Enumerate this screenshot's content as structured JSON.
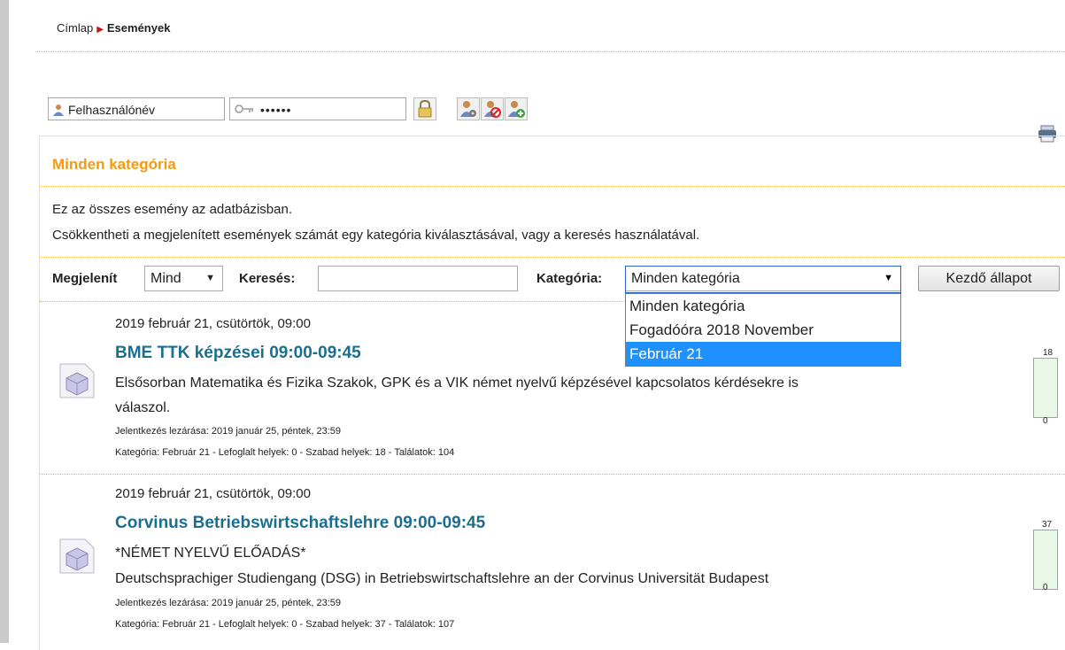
{
  "breadcrumb": {
    "home": "Címlap",
    "current": "Események"
  },
  "login": {
    "username_placeholder": "Felhasználónév",
    "password_value": "••••••"
  },
  "category": {
    "title": "Minden kategória",
    "description_line1": "Ez az összes esemény az adatbázisban.",
    "description_line2": "Csökkentheti a megjelenített események számát egy kategória kiválasztásával, vagy a keresés használatával."
  },
  "filters": {
    "show_label": "Megjelenít",
    "show_value": "Mind",
    "search_label": "Keresés:",
    "search_value": "",
    "category_label": "Kategória:",
    "category_value": "Minden kategória",
    "category_options": [
      "Minden kategória",
      "Fogadóóra 2018 November",
      "Február 21"
    ],
    "highlighted_option": "Február 21",
    "reset_button": "Kezdő állapot"
  },
  "events": [
    {
      "date": "2019 február 21, csütörtök, 09:00",
      "title": "BME TTK képzései 09:00-09:45",
      "description_line1": "Elsősorban Matematika és Fizika Szakok, GPK és a VIK német nyelvű képzésével kapcsolatos kérdésekre is",
      "description_line2": "válaszol.",
      "deadline": "Jelentkezés lezárása: 2019 január 25, péntek, 23:59",
      "meta": "Kategória: Február 21 - Lefoglalt helyek: 0 - Szabad helyek: 18 - Találatok: 104",
      "capacity_max": "18",
      "capacity_min": "0",
      "booked": 0
    },
    {
      "date": "2019 február 21, csütörtök, 09:00",
      "title": "Corvinus Betriebswirtschaftslehre 09:00-09:45",
      "description_line1": "*NÉMET NYELVŰ ELŐADÁS*",
      "description_line2": "Deutschsprachiger Studiengang (DSG) in Betriebswirtschaftslehre an der Corvinus Universität Budapest",
      "deadline": "Jelentkezés lezárása: 2019 január 25, péntek, 23:59",
      "meta": "Kategória: Február 21 - Lefoglalt helyek: 0 - Szabad helyek: 37 - Találatok: 107",
      "capacity_max": "37",
      "capacity_min": "0",
      "booked": 0
    }
  ],
  "colors": {
    "accent": "#f39a11",
    "link": "#1b6f8e",
    "highlight": "#1e90ff",
    "bar_fill": "#e8f7e8"
  }
}
